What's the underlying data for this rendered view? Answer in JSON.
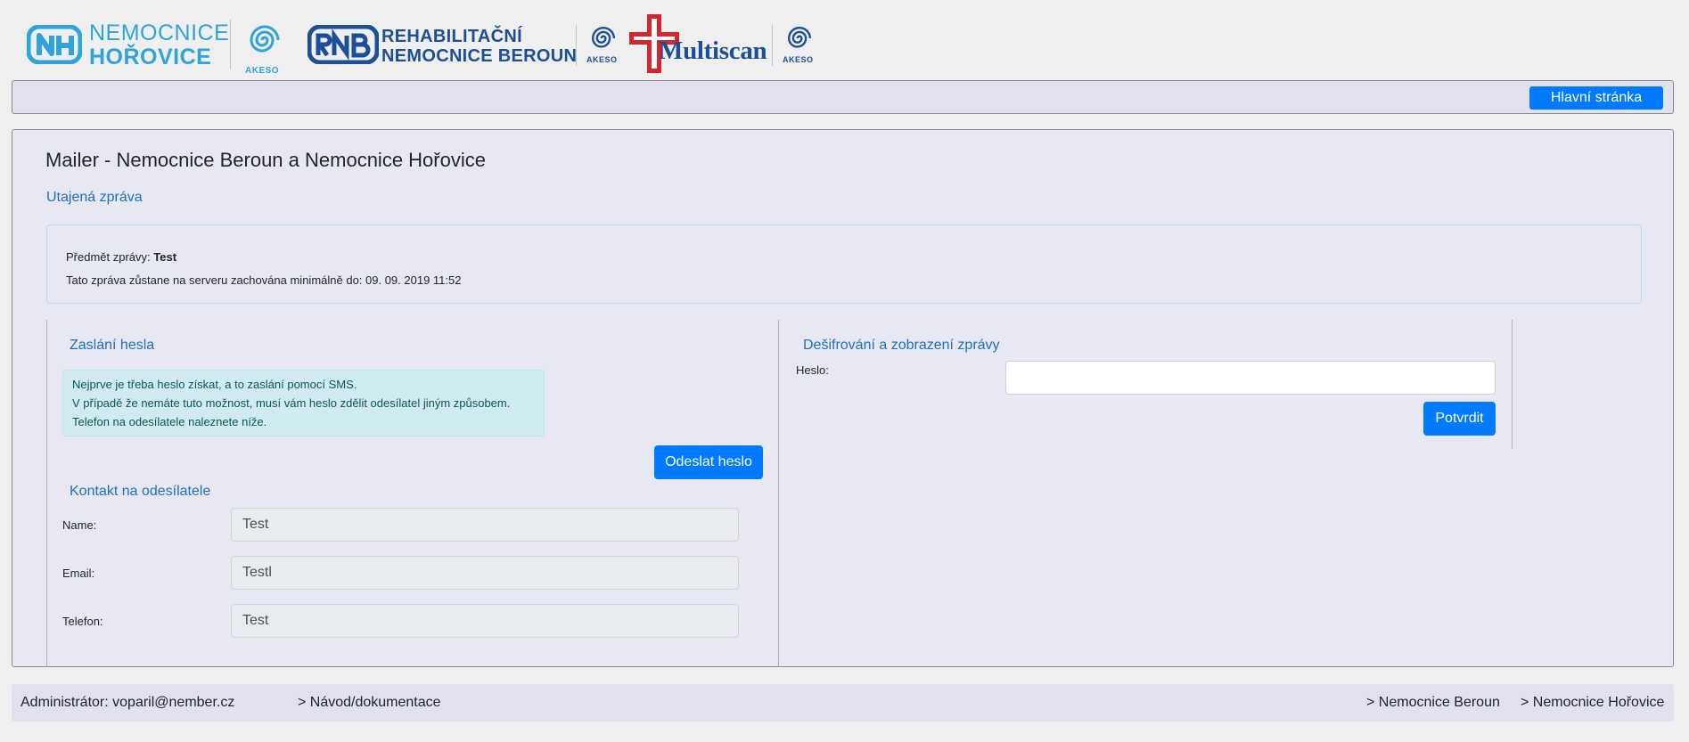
{
  "logos": {
    "nh_line1": "NEMOCNICE",
    "nh_line2": "HOŘOVICE",
    "akeso": "AKESO",
    "rnb_line1": "REHABILITAČNÍ",
    "rnb_line2": "NEMOCNICE BEROUN",
    "multiscan": "Multiscan"
  },
  "colors": {
    "primary": "#007bff",
    "link": "#1f6fbf",
    "logo_light": "#2ea3dc",
    "logo_dark": "#1c4f95",
    "cross_red": "#d22630"
  },
  "navbar": {
    "home_button": "Hlavní stránka"
  },
  "main": {
    "title": "Mailer - Nemocnice Beroun a Nemocnice Hořovice",
    "secret_link": "Utajená zpráva",
    "info": {
      "subject_label": "Předmět zprávy:",
      "subject_value": "Test",
      "retention_text": "Tato zpráva zůstane na serveru zachována minimálně do: 09. 09. 2019 11:52"
    },
    "send_password": {
      "heading": "Zaslání hesla",
      "alert_lines": [
        "Nejprve je třeba heslo získat, a to zaslání pomocí SMS.",
        "V případě že nemáte tuto možnost, musí vám heslo zdělit odesílatel jiným způsobem.",
        "Telefon na odesílatele naleznete níže."
      ],
      "button": "Odeslat heslo"
    },
    "contact": {
      "heading": "Kontakt na odesílatele",
      "name_label": "Name:",
      "name_value": "Test",
      "email_label": "Email:",
      "email_value": "Testl",
      "phone_label": "Telefon:",
      "phone_value": "Test"
    },
    "decrypt": {
      "heading": "Dešifrování a zobrazení zprávy",
      "password_label": "Heslo:",
      "password_value": "",
      "button": "Potvrdit"
    }
  },
  "footer": {
    "admin": "Administrátor: voparil@nember.cz",
    "docs_link": "> Návod/dokumentace",
    "link_beroun": "> Nemocnice Beroun",
    "link_horovice": "> Nemocnice Hořovice"
  }
}
